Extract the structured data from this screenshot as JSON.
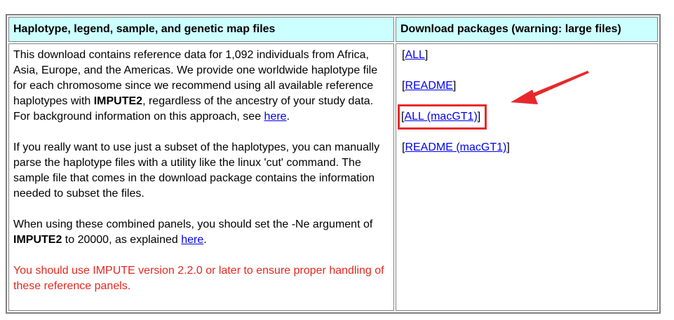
{
  "table": {
    "header_left": "Haplotype, legend, sample, and genetic map files",
    "header_right": "Download packages (warning: large files)"
  },
  "description": {
    "p1_a": "This download contains reference data for 1,092 individuals from Africa, Asia, Europe, and the Americas. We provide one worldwide haplotype file for each chromosome since we recommend using all available reference haplotypes with ",
    "p1_bold": "IMPUTE2",
    "p1_b": ", regardless of the ancestry of your study data. For background information on this approach, see ",
    "p1_link": "here",
    "p1_end": ".",
    "p2": "If you really want to use just a subset of the haplotypes, you can manually parse the haplotype files with a utility like the linux 'cut' command. The sample file that comes in the download package contains the information needed to subset the files.",
    "p3_a": "When using these combined panels, you should set the -Ne argument of ",
    "p3_bold": "IMPUTE2",
    "p3_b": " to 20000, as explained ",
    "p3_link": "here",
    "p3_end": ".",
    "warning": "You should use IMPUTE version 2.2.0 or later to ensure proper handling of these reference panels."
  },
  "downloads": {
    "open_bracket": "[",
    "close_bracket": "]",
    "items": [
      {
        "label": "ALL"
      },
      {
        "label": "README"
      },
      {
        "label": "ALL (macGT1)"
      },
      {
        "label": "README (macGT1)"
      }
    ]
  },
  "colors": {
    "header_bg": "#ccffff",
    "link": "#0000ee",
    "warning_text": "#e8261c",
    "annotation": "#e8282b"
  }
}
